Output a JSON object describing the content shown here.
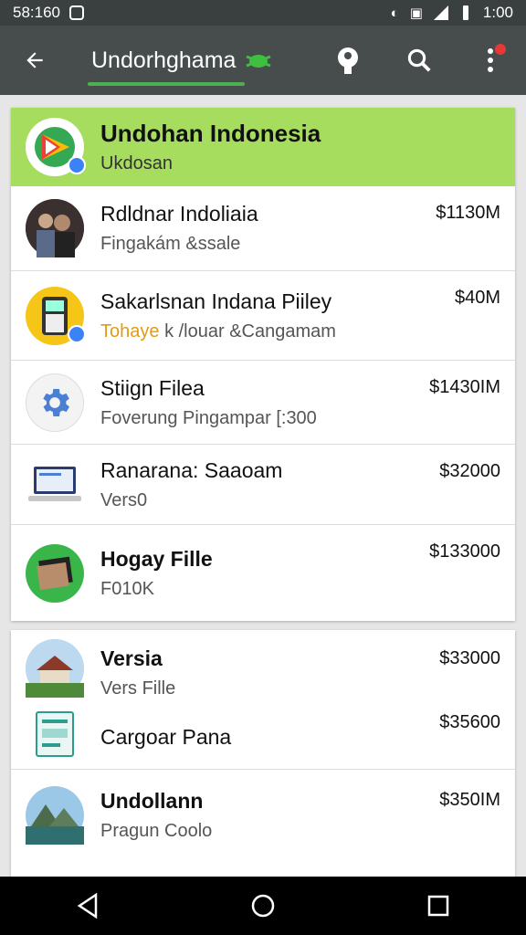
{
  "status_bar": {
    "time_left": "58:160",
    "time_right": "1:00"
  },
  "toolbar": {
    "title": "Undorhghama",
    "back_icon": "arrow-back-icon",
    "actions": [
      "account-icon",
      "search-icon",
      "more-vert-icon"
    ]
  },
  "header_card": {
    "title": "Undohan Indonesia",
    "subtitle": "Ukdosan"
  },
  "items": [
    {
      "title": "Rdldnar Indoliaia",
      "subtitle": "Fingakám &ssale",
      "price": "$1130M"
    },
    {
      "title": "Sakarlsnan Indana Piiley",
      "subtitle_highlight": "Tohaye",
      "subtitle": "k /louar &Cangamam",
      "price": "$40M"
    },
    {
      "title": "Stiign Filea",
      "subtitle": "Foverung Pingampar [:300",
      "price": "$1430IM"
    },
    {
      "title": "Ranarana: Saaoam",
      "subtitle": "Vers0",
      "price": "$32000"
    },
    {
      "title": "Hogay Fille",
      "subtitle": "F010K",
      "price": "$133000"
    }
  ],
  "items2": [
    {
      "title": "Versia",
      "subtitle": "Vers Fille",
      "price": "$33000"
    },
    {
      "title": "Cargoar Pana",
      "price": "$35600"
    },
    {
      "title": "Undollann",
      "subtitle": "Pragun Coolo",
      "price": "$350IM"
    }
  ],
  "colors": {
    "accent": "#4caf50",
    "header_green": "#a6dd5f",
    "toolbar": "#474d4d"
  }
}
